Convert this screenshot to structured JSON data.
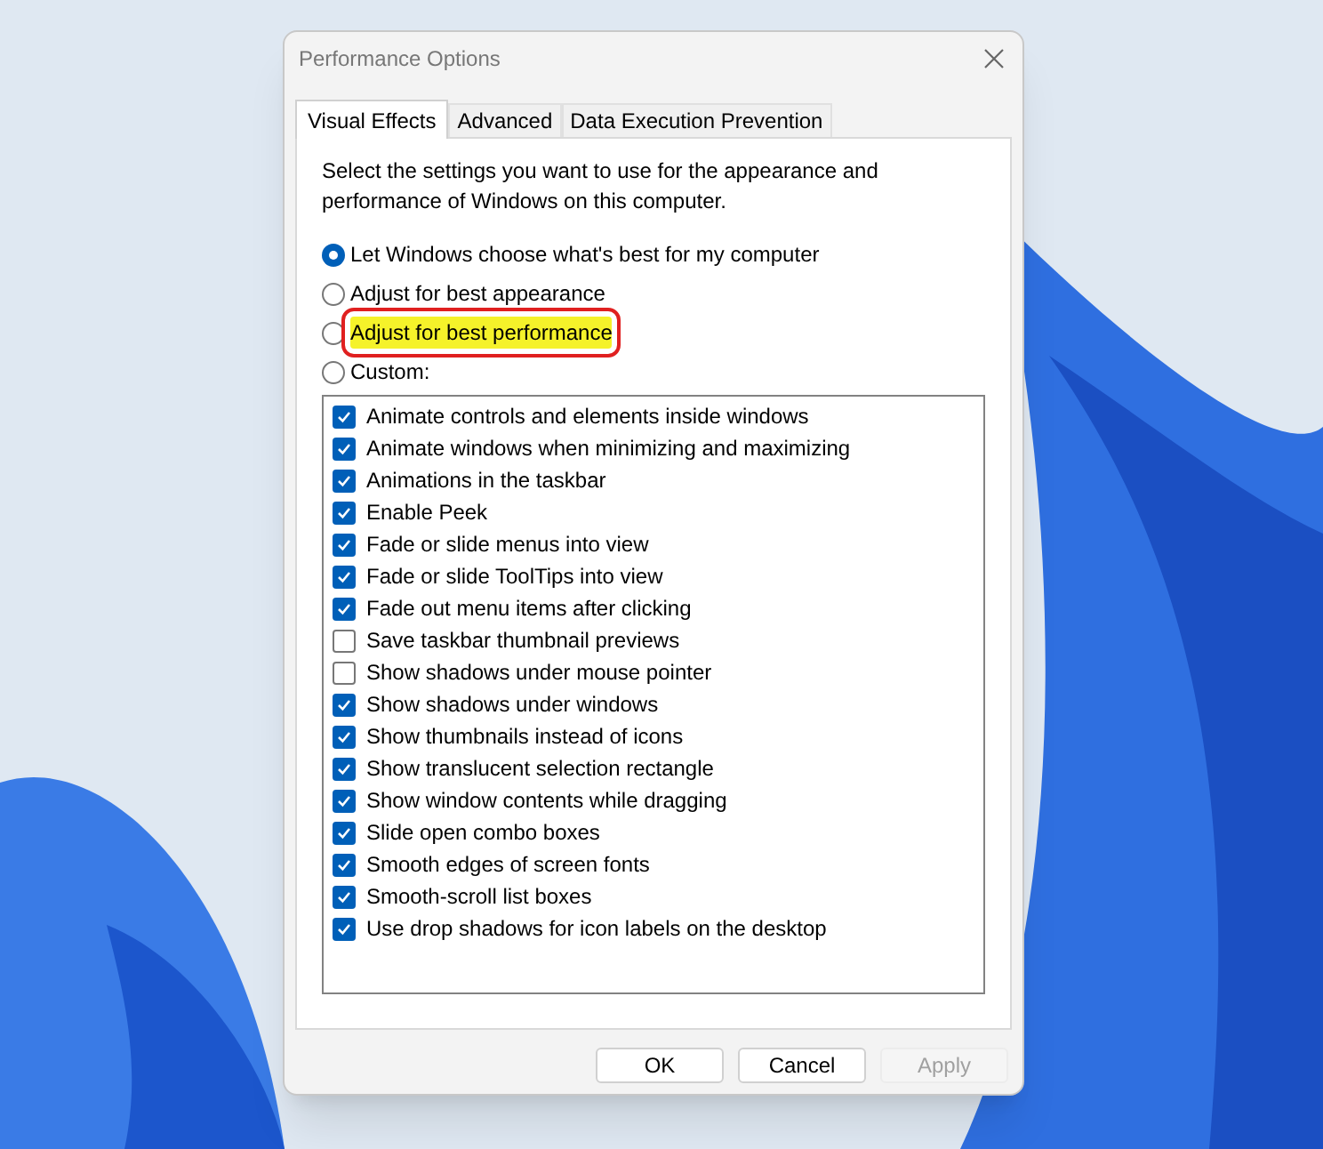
{
  "window": {
    "title": "Performance Options"
  },
  "tabs": [
    {
      "label": "Visual Effects",
      "selected": true
    },
    {
      "label": "Advanced",
      "selected": false
    },
    {
      "label": "Data Execution Prevention",
      "selected": false
    }
  ],
  "description": "Select the settings you want to use for the appearance and performance of Windows on this computer.",
  "options": [
    {
      "label": "Let Windows choose what's best for my computer",
      "selected": true,
      "highlighted": false
    },
    {
      "label": "Adjust for best appearance",
      "selected": false,
      "highlighted": false
    },
    {
      "label": "Adjust for best performance",
      "selected": false,
      "highlighted": true
    },
    {
      "label": "Custom:",
      "selected": false,
      "highlighted": false
    }
  ],
  "effects": [
    {
      "label": "Animate controls and elements inside windows",
      "checked": true
    },
    {
      "label": "Animate windows when minimizing and maximizing",
      "checked": true
    },
    {
      "label": "Animations in the taskbar",
      "checked": true
    },
    {
      "label": "Enable Peek",
      "checked": true
    },
    {
      "label": "Fade or slide menus into view",
      "checked": true
    },
    {
      "label": "Fade or slide ToolTips into view",
      "checked": true
    },
    {
      "label": "Fade out menu items after clicking",
      "checked": true
    },
    {
      "label": "Save taskbar thumbnail previews",
      "checked": false
    },
    {
      "label": "Show shadows under mouse pointer",
      "checked": false
    },
    {
      "label": "Show shadows under windows",
      "checked": true
    },
    {
      "label": "Show thumbnails instead of icons",
      "checked": true
    },
    {
      "label": "Show translucent selection rectangle",
      "checked": true
    },
    {
      "label": "Show window contents while dragging",
      "checked": true
    },
    {
      "label": "Slide open combo boxes",
      "checked": true
    },
    {
      "label": "Smooth edges of screen fonts",
      "checked": true
    },
    {
      "label": "Smooth-scroll list boxes",
      "checked": true
    },
    {
      "label": "Use drop shadows for icon labels on the desktop",
      "checked": true
    }
  ],
  "buttons": [
    {
      "label": "OK",
      "disabled": false
    },
    {
      "label": "Cancel",
      "disabled": false
    },
    {
      "label": "Apply",
      "disabled": true
    }
  ]
}
